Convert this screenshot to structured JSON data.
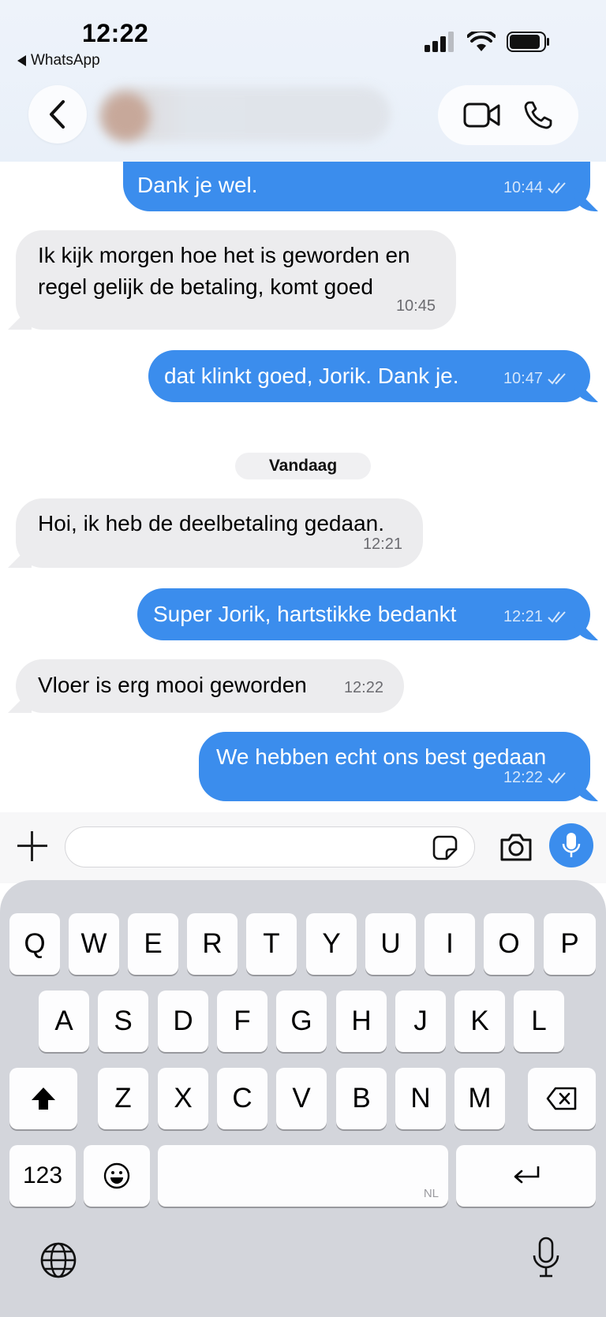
{
  "status_bar": {
    "time": "12:22",
    "back_app": "WhatsApp"
  },
  "header": {
    "video_icon": "video-camera-icon",
    "phone_icon": "phone-icon"
  },
  "messages": [
    {
      "dir": "out",
      "text": "Dank je wel.",
      "time": "10:44",
      "ticks": "read"
    },
    {
      "dir": "in",
      "text_line1": "Ik kijk morgen hoe het is geworden en",
      "text_line2": "regel gelijk de betaling, komt goed",
      "time": "10:45"
    },
    {
      "dir": "out",
      "text": "dat klinkt goed, Jorik. Dank je.",
      "time": "10:47",
      "ticks": "read"
    },
    {
      "dir": "in",
      "text": "Hoi, ik heb de deelbetaling gedaan.",
      "time": "12:21"
    },
    {
      "dir": "out",
      "text": "Super Jorik, hartstikke bedankt",
      "time": "12:21",
      "ticks": "read"
    },
    {
      "dir": "in",
      "text": "Vloer is erg mooi geworden",
      "time": "12:22"
    },
    {
      "dir": "out",
      "text": "We hebben echt ons best gedaan",
      "time": "12:22",
      "ticks": "read"
    }
  ],
  "date_separator": "Vandaag",
  "composer": {
    "placeholder": ""
  },
  "keyboard": {
    "row1": [
      "Q",
      "W",
      "E",
      "R",
      "T",
      "Y",
      "U",
      "I",
      "O",
      "P"
    ],
    "row2": [
      "A",
      "S",
      "D",
      "F",
      "G",
      "H",
      "J",
      "K",
      "L"
    ],
    "row3": [
      "Z",
      "X",
      "C",
      "V",
      "B",
      "N",
      "M"
    ],
    "numbers_key": "123",
    "space_lang": "NL"
  },
  "colors": {
    "outgoing": "#3b8ded",
    "incoming": "#ececee"
  }
}
